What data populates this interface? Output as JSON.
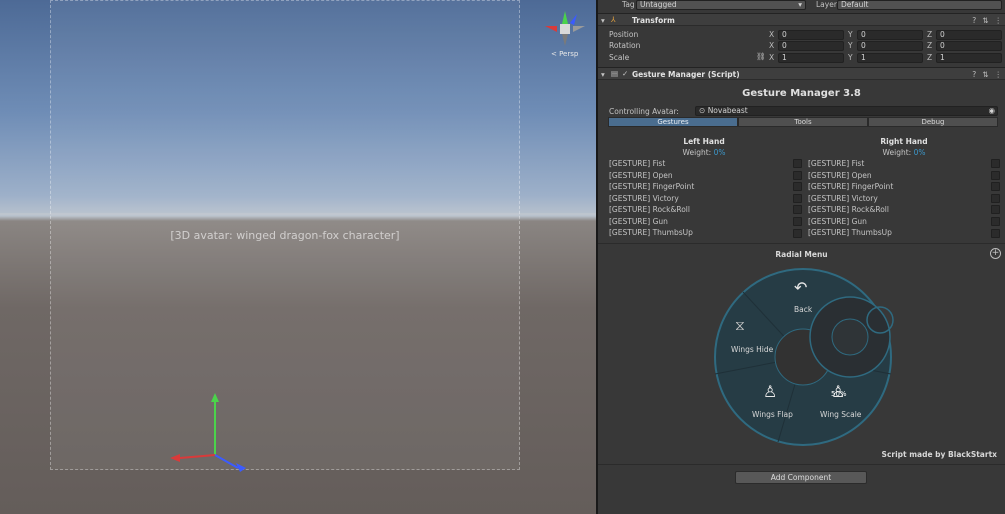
{
  "scene": {
    "view_mode": "< Persp",
    "character_placeholder": "[3D avatar: winged dragon-fox character]"
  },
  "inspector": {
    "tag_label": "Tag",
    "tag_value": "Untagged",
    "layer_label": "Layer",
    "layer_value": "Default",
    "transform": {
      "title": "Transform",
      "position_label": "Position",
      "rotation_label": "Rotation",
      "scale_label": "Scale",
      "position": {
        "x": "0",
        "y": "0",
        "z": "0"
      },
      "rotation": {
        "x": "0",
        "y": "0",
        "z": "0"
      },
      "scale": {
        "x": "1",
        "y": "1",
        "z": "1"
      }
    },
    "component": {
      "title": "Gesture Manager (Script)",
      "heading": "Gesture Manager 3.8",
      "controlling_avatar_label": "Controlling Avatar:",
      "controlling_avatar_value": "Novabeast",
      "tabs": [
        "Gestures",
        "Tools",
        "Debug"
      ],
      "left_hand": {
        "title": "Left Hand",
        "weight_label": "Weight:",
        "weight_value": "0%",
        "gestures": [
          "[GESTURE] Fist",
          "[GESTURE] Open",
          "[GESTURE] FingerPoint",
          "[GESTURE] Victory",
          "[GESTURE] Rock&Roll",
          "[GESTURE] Gun",
          "[GESTURE] ThumbsUp"
        ]
      },
      "right_hand": {
        "title": "Right Hand",
        "weight_label": "Weight:",
        "weight_value": "0%",
        "gestures": [
          "[GESTURE] Fist",
          "[GESTURE] Open",
          "[GESTURE] FingerPoint",
          "[GESTURE] Victory",
          "[GESTURE] Rock&Roll",
          "[GESTURE] Gun",
          "[GESTURE] ThumbsUp"
        ]
      },
      "radial_menu": {
        "title": "Radial Menu",
        "items": {
          "back": "Back",
          "wings_hide": "Wings Hide",
          "wings_flap": "Wings Flap",
          "wings_scale": "Wing Scale",
          "wings_scale_value": "50%"
        }
      },
      "credit": "Script made by BlackStartx"
    },
    "add_component_label": "Add Component"
  },
  "colors": {
    "accent": "#3c96c8",
    "tab_active": "#4a6d8f",
    "radial_ring": "#2d5a6d"
  }
}
